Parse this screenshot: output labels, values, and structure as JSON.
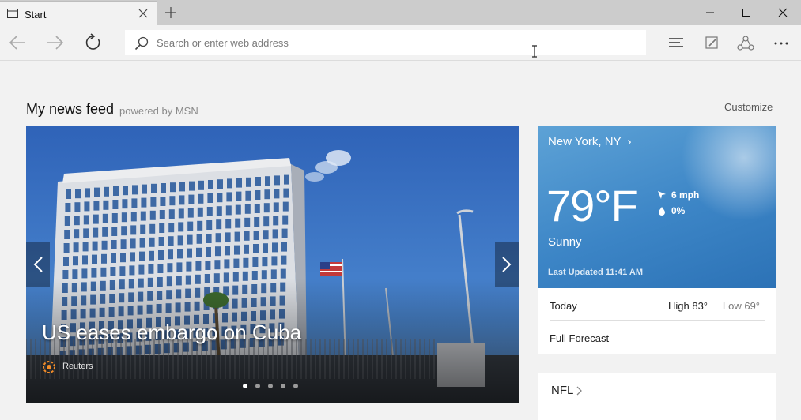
{
  "tab": {
    "title": "Start"
  },
  "address": {
    "placeholder": "Search or enter web address",
    "value": ""
  },
  "feed": {
    "title": "My news feed",
    "powered_by": "powered by MSN",
    "customize_label": "Customize"
  },
  "hero": {
    "headline": "US eases embargo on Cuba",
    "source": "Reuters",
    "slide_count": 5,
    "active_slide": 1
  },
  "weather": {
    "location": "New York, NY",
    "temperature": "79°F",
    "condition": "Sunny",
    "wind": "6 mph",
    "precipitation": "0%",
    "updated": "Last Updated 11:41 AM",
    "today_label": "Today",
    "high": "High 83°",
    "low": "Low 69°",
    "forecast_label": "Full Forecast"
  },
  "nfl": {
    "label": "NFL"
  },
  "icons": {
    "tab": "tab-page-icon",
    "close": "close-icon",
    "new_tab": "plus-icon",
    "back": "arrow-left-icon",
    "forward": "arrow-right-icon",
    "refresh": "refresh-icon",
    "search": "search-icon",
    "hub": "hub-icon",
    "note": "web-note-icon",
    "share": "share-icon",
    "more": "more-icon"
  },
  "colors": {
    "weather_blue": "#3c85c6",
    "titlebar": "#cccccc",
    "background": "#f2f2f2"
  }
}
